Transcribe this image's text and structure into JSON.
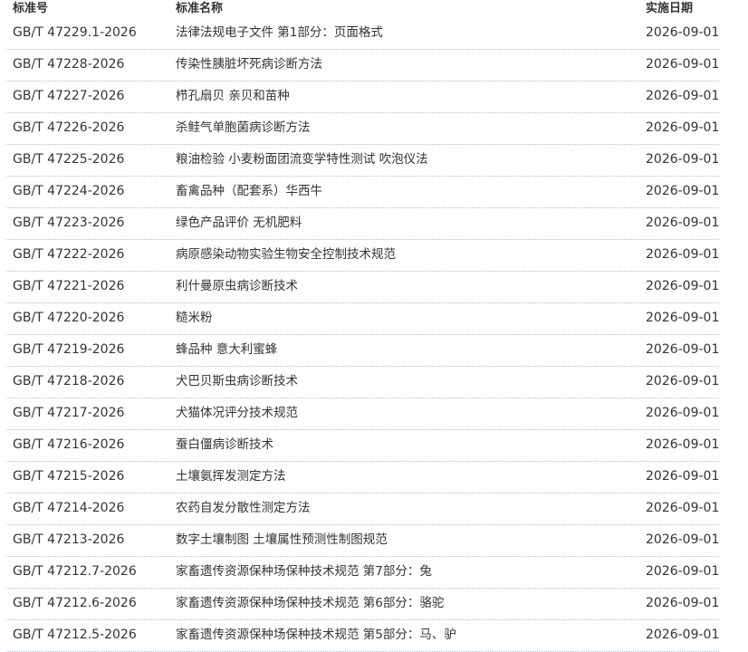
{
  "header": {
    "col_code": "标准号",
    "col_name": "标准名称",
    "col_date": "实施日期"
  },
  "rows": [
    {
      "code": "GB/T 47229.1-2026",
      "name": "法律法规电子文件 第1部分：页面格式",
      "date": "2026-09-01"
    },
    {
      "code": "GB/T 47228-2026",
      "name": "传染性胰脏坏死病诊断方法",
      "date": "2026-09-01"
    },
    {
      "code": "GB/T 47227-2026",
      "name": "栉孔扇贝 亲贝和苗种",
      "date": "2026-09-01"
    },
    {
      "code": "GB/T 47226-2026",
      "name": "杀鲑气单胞菌病诊断方法",
      "date": "2026-09-01"
    },
    {
      "code": "GB/T 47225-2026",
      "name": "粮油检验 小麦粉面团流变学特性测试 吹泡仪法",
      "date": "2026-09-01"
    },
    {
      "code": "GB/T 47224-2026",
      "name": "畜禽品种（配套系）华西牛",
      "date": "2026-09-01"
    },
    {
      "code": "GB/T 47223-2026",
      "name": "绿色产品评价 无机肥料",
      "date": "2026-09-01"
    },
    {
      "code": "GB/T 47222-2026",
      "name": "病原感染动物实验生物安全控制技术规范",
      "date": "2026-09-01"
    },
    {
      "code": "GB/T 47221-2026",
      "name": "利什曼原虫病诊断技术",
      "date": "2026-09-01"
    },
    {
      "code": "GB/T 47220-2026",
      "name": "糙米粉",
      "date": "2026-09-01"
    },
    {
      "code": "GB/T 47219-2026",
      "name": "蜂品种 意大利蜜蜂",
      "date": "2026-09-01"
    },
    {
      "code": "GB/T 47218-2026",
      "name": "犬巴贝斯虫病诊断技术",
      "date": "2026-09-01"
    },
    {
      "code": "GB/T 47217-2026",
      "name": "犬猫体况评分技术规范",
      "date": "2026-09-01"
    },
    {
      "code": "GB/T 47216-2026",
      "name": "蚕白僵病诊断技术",
      "date": "2026-09-01"
    },
    {
      "code": "GB/T 47215-2026",
      "name": "土壤氨挥发测定方法",
      "date": "2026-09-01"
    },
    {
      "code": "GB/T 47214-2026",
      "name": "农药自发分散性测定方法",
      "date": "2026-09-01"
    },
    {
      "code": "GB/T 47213-2026",
      "name": "数字土壤制图 土壤属性预测性制图规范",
      "date": "2026-09-01"
    },
    {
      "code": "GB/T 47212.7-2026",
      "name": "家畜遗传资源保种场保种技术规范 第7部分：兔",
      "date": "2026-09-01"
    },
    {
      "code": "GB/T 47212.6-2026",
      "name": "家畜遗传资源保种场保种技术规范 第6部分：骆驼",
      "date": "2026-09-01"
    },
    {
      "code": "GB/T 47212.5-2026",
      "name": "家畜遗传资源保种场保种技术规范 第5部分：马、驴",
      "date": "2026-09-01"
    }
  ]
}
